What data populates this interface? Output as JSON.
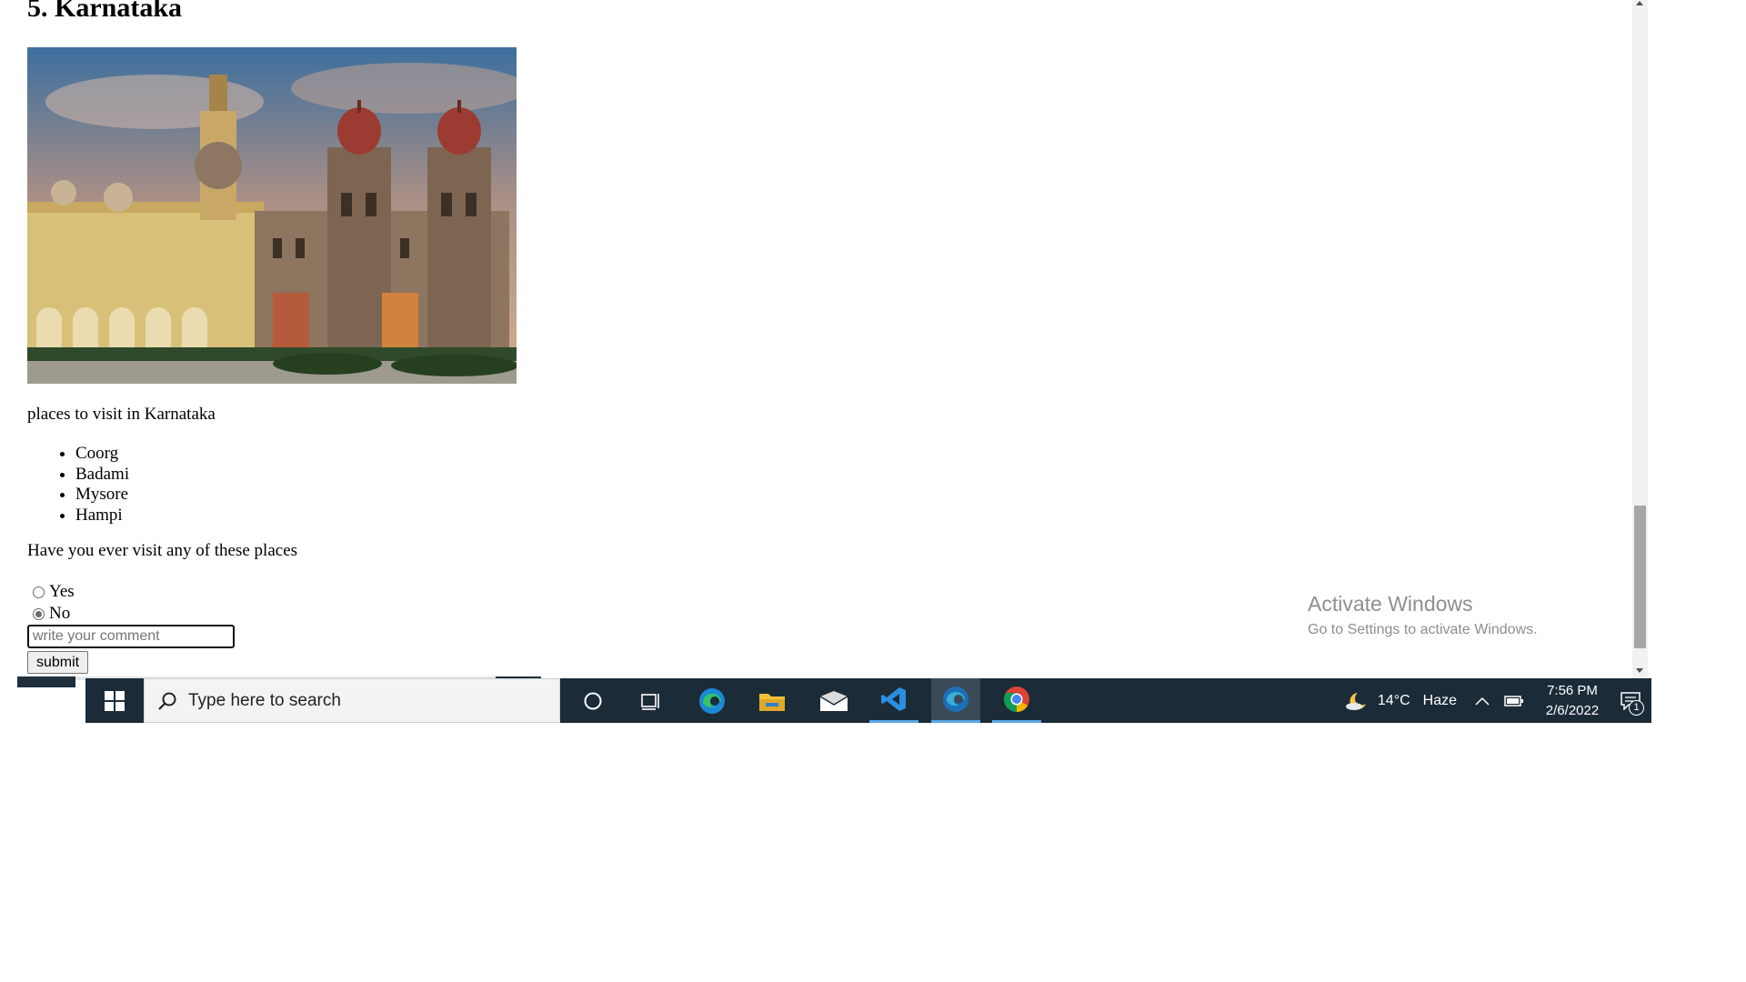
{
  "page": {
    "heading": "5. Karnataka",
    "intro": "places to visit in Karnataka",
    "places": [
      "Coorg",
      "Badami",
      "Mysore",
      "Hampi"
    ],
    "question": "Have you ever visit any of these places",
    "options": [
      {
        "label": "Yes",
        "checked": false
      },
      {
        "label": "No",
        "checked": true
      }
    ],
    "comment_placeholder": "write your comment",
    "submit_label": "submit"
  },
  "watermark": {
    "title": "Activate Windows",
    "subtitle": "Go to Settings to activate Windows."
  },
  "taskbar": {
    "search_placeholder": "Type here to search",
    "apps": [
      "cortana-icon",
      "task-view-icon",
      "edge-icon",
      "file-explorer-icon",
      "mail-icon",
      "vscode-icon",
      "edge-dev-icon",
      "chrome-icon"
    ],
    "weather_temp": "14°C",
    "weather_condition": "Haze",
    "time": "7:56 PM",
    "date": "2/6/2022",
    "notification_count": "1"
  }
}
